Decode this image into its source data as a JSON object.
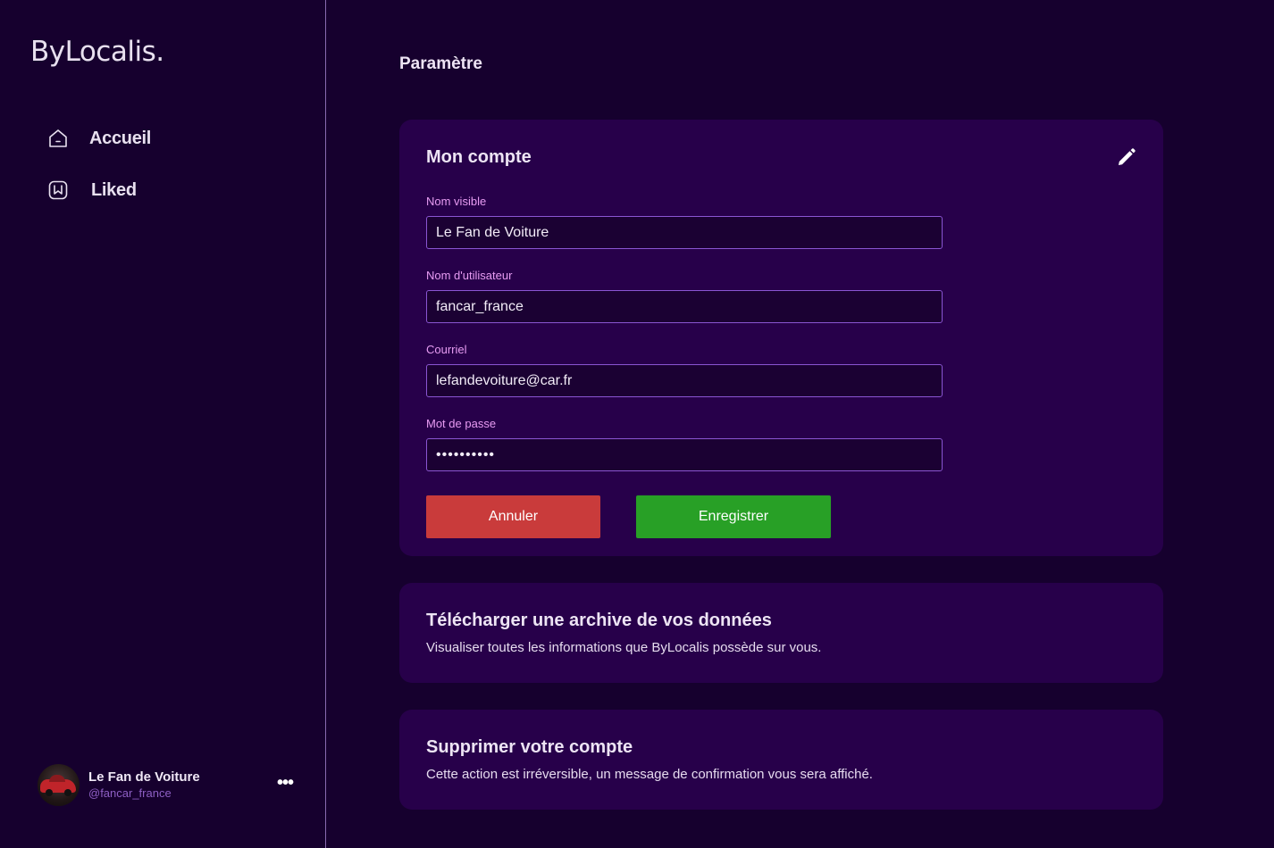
{
  "app": {
    "logo": "ByLocalis."
  },
  "sidebar": {
    "items": [
      {
        "label": "Accueil",
        "icon": "home-icon"
      },
      {
        "label": "Liked",
        "icon": "bookmark-icon"
      }
    ],
    "profile": {
      "name": "Le Fan de Voiture",
      "handle": "@fancar_france",
      "more": "•••"
    }
  },
  "main": {
    "title": "Paramètre",
    "account": {
      "title": "Mon compte",
      "edit_icon": "pencil-icon",
      "fields": {
        "display_name": {
          "label": "Nom visible",
          "value": "Le Fan de Voiture"
        },
        "username": {
          "label": "Nom d'utilisateur",
          "value": "fancar_france"
        },
        "email": {
          "label": "Courriel",
          "value": "lefandevoiture@car.fr"
        },
        "password": {
          "label": "Mot de passe",
          "value": "••••••••••"
        }
      },
      "cancel_label": "Annuler",
      "save_label": "Enregistrer"
    },
    "archive": {
      "title": "Télécharger une archive de vos données",
      "description": "Visualiser toutes les informations que ByLocalis possède sur vous."
    },
    "delete": {
      "title": "Supprimer votre compte",
      "description": "Cette action est irréversible, un message de confirmation vous sera affiché."
    }
  },
  "colors": {
    "background": "#16002e",
    "card": "#27004a",
    "label": "#e79cf2",
    "cancel": "#c93b3b",
    "save": "#28a026",
    "handle": "#8e5fc4"
  }
}
